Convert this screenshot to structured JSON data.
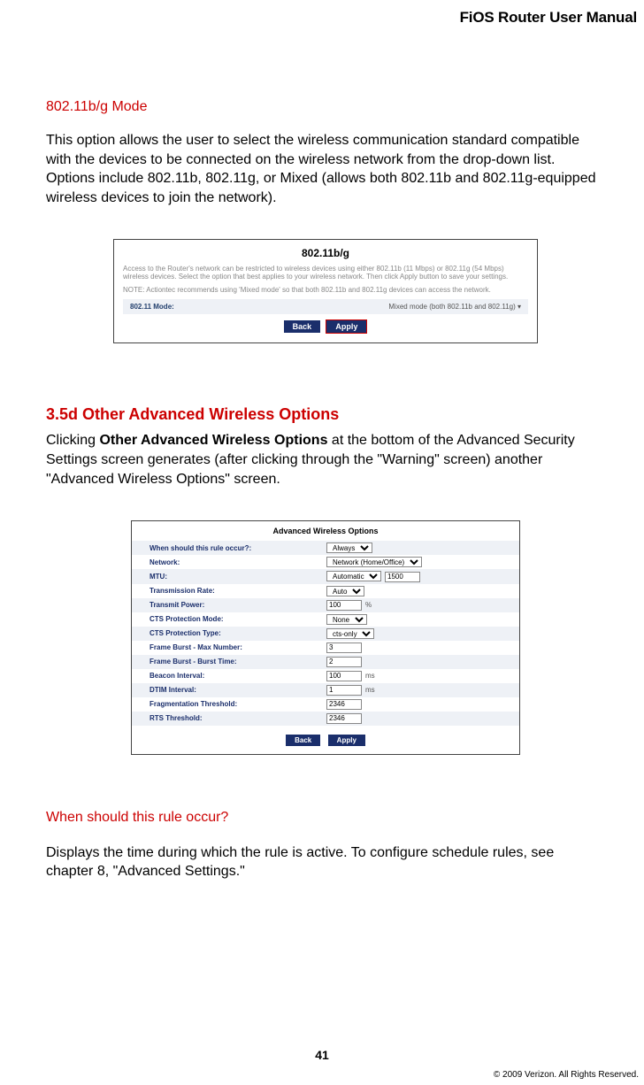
{
  "header": {
    "title": "FiOS Router User Manual"
  },
  "s1": {
    "heading": "802.11b/g Mode",
    "p1": "This option allows the user to select the wireless communication standard compatible with the devices to be connected on the wireless network from the drop-down list. Options include 802.11b, 802.11g, or Mixed (allows both 802.11b and 802.11g-equipped wireless devices to join the network)."
  },
  "fig1": {
    "title": "802.11b/g",
    "desc": "Access to the Router's network can be restricted to wireless devices using either 802.11b (11 Mbps) or 802.11g (54 Mbps) wireless devices. Select the option that best applies to your wireless network. Then click Apply button to save your settings.",
    "note": "NOTE: Actiontec recommends using 'Mixed mode' so that both 802.11b and 802.11g devices can access the network.",
    "row_label": "802.11 Mode:",
    "row_value": "Mixed mode (both 802.11b and 802.11g)  ▾",
    "back": "Back",
    "apply": "Apply"
  },
  "s2": {
    "heading": "3.5d  Other Advanced Wireless Options",
    "p_pre": "Clicking ",
    "p_bold": "Other Advanced Wireless Options",
    "p_post": " at the bottom of the Advanced Security Settings screen generates (after clicking through the \"Warning\" screen) another \"Advanced Wireless Options\" screen."
  },
  "fig2": {
    "title": "Advanced Wireless Options",
    "rows": [
      {
        "label": "When should this rule occur?:",
        "ctrl": "select",
        "value": "Always",
        "unit": ""
      },
      {
        "label": "Network:",
        "ctrl": "select",
        "value": "Network (Home/Office)",
        "unit": ""
      },
      {
        "label": "MTU:",
        "ctrl": "select_input",
        "value": "Automatic",
        "input": "1500",
        "unit": ""
      },
      {
        "label": "Transmission Rate:",
        "ctrl": "select",
        "value": "Auto",
        "unit": ""
      },
      {
        "label": "Transmit Power:",
        "ctrl": "input",
        "value": "100",
        "unit": "%"
      },
      {
        "label": "CTS Protection Mode:",
        "ctrl": "select",
        "value": "None",
        "unit": ""
      },
      {
        "label": "CTS Protection Type:",
        "ctrl": "select",
        "value": "cts-only",
        "unit": ""
      },
      {
        "label": "Frame Burst - Max Number:",
        "ctrl": "input",
        "value": "3",
        "unit": ""
      },
      {
        "label": "Frame Burst - Burst Time:",
        "ctrl": "input",
        "value": "2",
        "unit": ""
      },
      {
        "label": "Beacon Interval:",
        "ctrl": "input",
        "value": "100",
        "unit": "ms"
      },
      {
        "label": "DTIM Interval:",
        "ctrl": "input",
        "value": "1",
        "unit": "ms"
      },
      {
        "label": "Fragmentation Threshold:",
        "ctrl": "input",
        "value": "2346",
        "unit": ""
      },
      {
        "label": "RTS Threshold:",
        "ctrl": "input",
        "value": "2346",
        "unit": ""
      }
    ],
    "back": "Back",
    "apply": "Apply"
  },
  "s3": {
    "heading": "When should this rule occur?",
    "p1": "Displays the time during which the rule is active. To configure schedule rules, see chapter 8, \"Advanced Settings.\""
  },
  "footer": {
    "page": "41",
    "copyright": "© 2009 Verizon. All Rights Reserved."
  }
}
